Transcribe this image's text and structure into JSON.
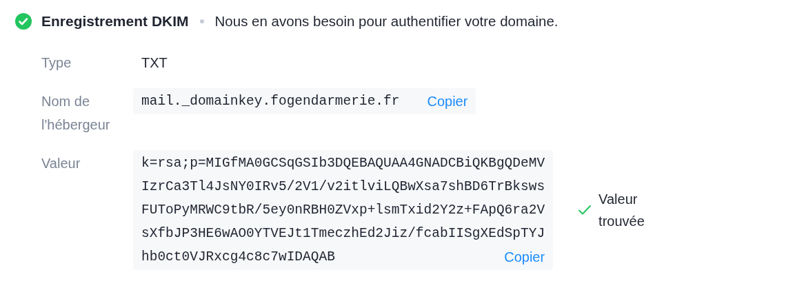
{
  "header": {
    "verified": true,
    "title": "Enregistrement DKIM",
    "description": "Nous en avons besoin pour authentifier votre domaine."
  },
  "fields": [
    {
      "kind": "plain",
      "label": "Type",
      "value": [
        "TXT"
      ]
    },
    {
      "kind": "copy",
      "label": "Nom de l'hébergeur",
      "value": [
        "mail._domainkey.fogendarmerie.fr"
      ],
      "copy": "Copier"
    },
    {
      "kind": "copy",
      "label": "Valeur",
      "value": [
        "k=rsa;p=MIGfMA0GCSqGSIb3DQEBAQUAA4GNADCBiQKBgQDeMV",
        "IzrCa3Tl4JsNY0IRv5/2V1/v2itlviLQBwXsa7shBD6TrBksws",
        "FUToPyMRWC9tbR/5ey0nRBH0ZVxp+lsmTxid2Y2z+FApQ6ra2V",
        "sXfbJP3HE6wAO0YTVEJt1TmeczhEd2Jiz/fcabIISgXEdSpTYJ",
        "hb0ct0VJRxcg4c8c7wIDAQAB"
      ],
      "copy": "Copier",
      "status": {
        "found": true,
        "text": "Valeur trouvée"
      }
    }
  ]
}
